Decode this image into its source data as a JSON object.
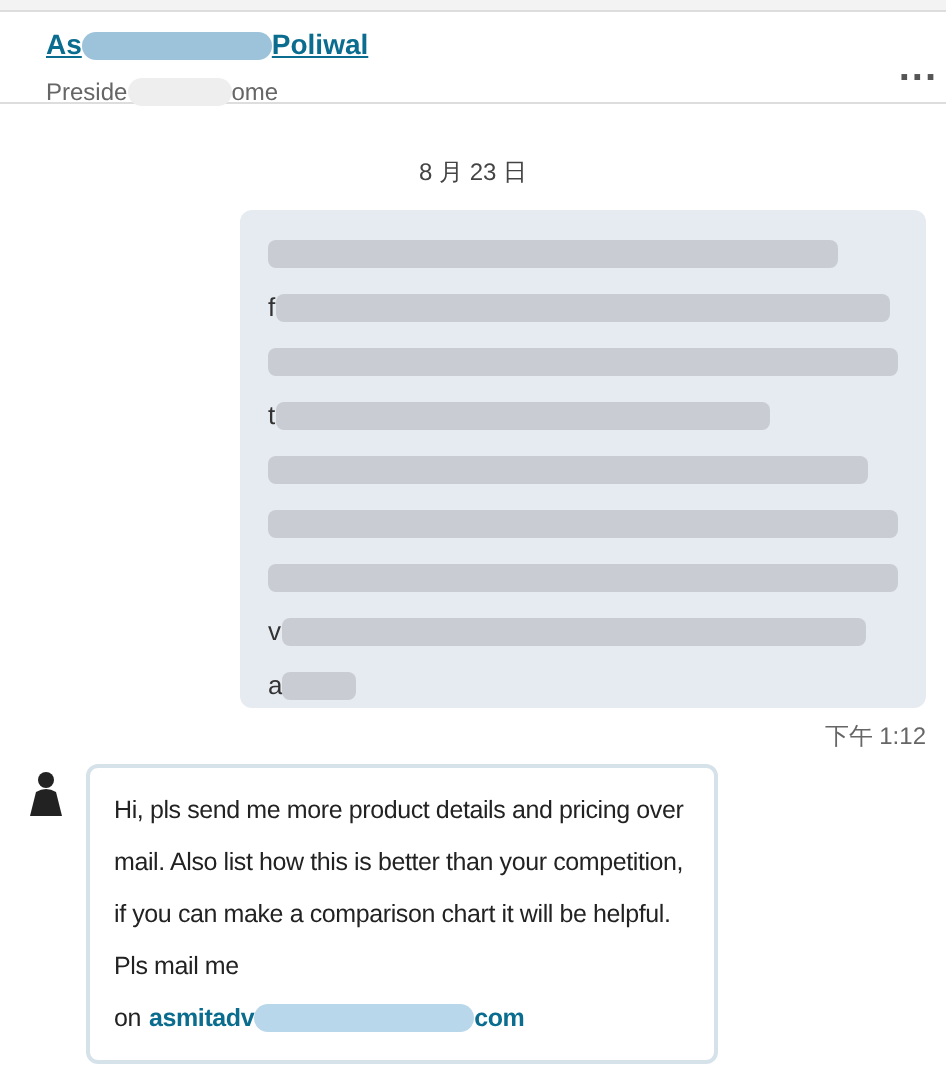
{
  "header": {
    "name_start": "As",
    "name_end": "Poliwal",
    "headline_start": "Preside",
    "headline_end": "ome",
    "more": "..."
  },
  "date": "8 月 23 日",
  "sent_message": {
    "lines": [
      {
        "kind": "hidden"
      },
      {
        "kind": "partial",
        "lead": "f"
      },
      {
        "kind": "hidden"
      },
      {
        "kind": "partial",
        "lead": "t"
      },
      {
        "kind": "hidden"
      },
      {
        "kind": "hidden"
      },
      {
        "kind": "hidden"
      },
      {
        "kind": "partial",
        "lead": "v"
      },
      {
        "kind": "partial",
        "lead": "a"
      }
    ],
    "time": "下午 1:12"
  },
  "received_message": {
    "text": "Hi, pls send me more product details and pricing over mail. Also list how this is better than your competition, if you can make a comparison chart it will be helpful. Pls mail me",
    "email_prefix": "on",
    "email_start": "asmitadv",
    "email_end": "com"
  }
}
